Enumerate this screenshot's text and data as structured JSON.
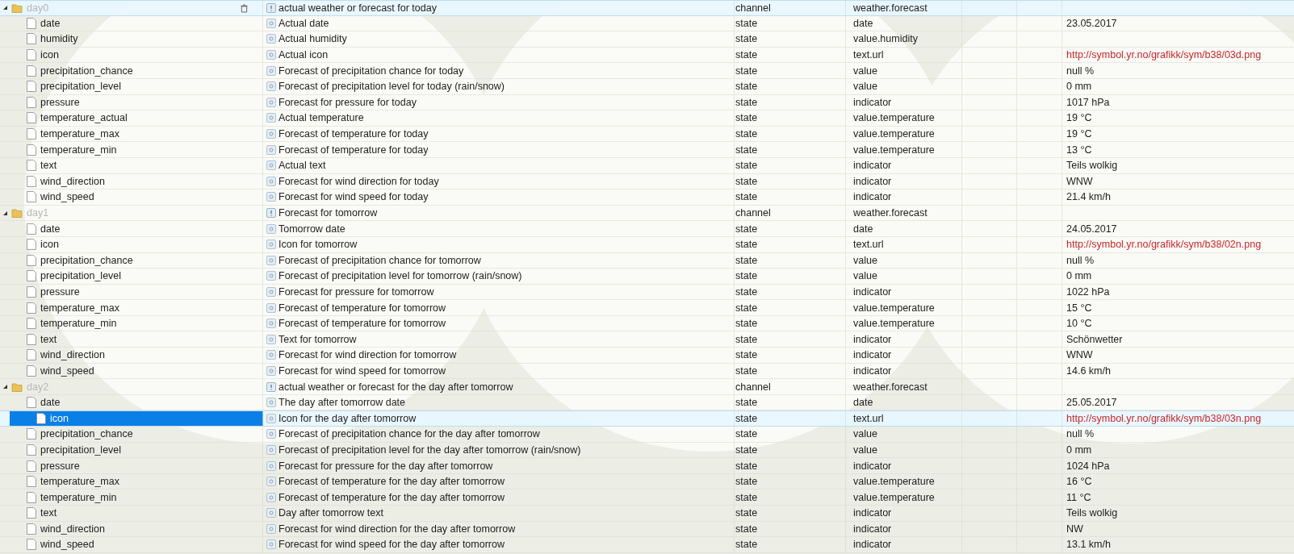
{
  "groups": [
    {
      "name": "day0",
      "description": "actual weather or forecast for today",
      "type": "channel",
      "role": "weather.forecast",
      "expanded": true,
      "highlighted": true,
      "children": [
        {
          "name": "date",
          "description": "Actual date",
          "type": "state",
          "role": "date",
          "value": "23.05.2017",
          "kind": "plain",
          "selected": false
        },
        {
          "name": "humidity",
          "description": "Actual humidity",
          "type": "state",
          "role": "value.humidity",
          "selected": false
        },
        {
          "name": "icon",
          "description": "Actual icon",
          "type": "state",
          "role": "text.url",
          "value": "http://symbol.yr.no/grafikk/sym/b38/03d.png",
          "kind": "url",
          "selected": false
        },
        {
          "name": "precipitation_chance",
          "description": "Forecast of precipitation chance for today",
          "type": "state",
          "role": "value",
          "value": "null %",
          "kind": "plain",
          "selected": false
        },
        {
          "name": "precipitation_level",
          "description": "Forecast of precipitation level for today (rain/snow)",
          "type": "state",
          "role": "value",
          "value": "0 mm",
          "kind": "plain",
          "selected": false
        },
        {
          "name": "pressure",
          "description": "Forecast for pressure for today",
          "type": "state",
          "role": "indicator",
          "value": "1017 hPa",
          "kind": "plain",
          "selected": false
        },
        {
          "name": "temperature_actual",
          "description": "Actual temperature",
          "type": "state",
          "role": "value.temperature",
          "value": "19 °C",
          "kind": "plain",
          "selected": false
        },
        {
          "name": "temperature_max",
          "description": "Forecast of temperature for today",
          "type": "state",
          "role": "value.temperature",
          "value": "19 °C",
          "kind": "plain",
          "selected": false
        },
        {
          "name": "temperature_min",
          "description": "Forecast of temperature for today",
          "type": "state",
          "role": "value.temperature",
          "value": "13 °C",
          "kind": "plain",
          "selected": false
        },
        {
          "name": "text",
          "description": "Actual text",
          "type": "state",
          "role": "indicator",
          "value": "Teils wolkig",
          "kind": "plain",
          "selected": false
        },
        {
          "name": "wind_direction",
          "description": "Forecast for wind direction for today",
          "type": "state",
          "role": "indicator",
          "value": "WNW",
          "kind": "plain",
          "selected": false
        },
        {
          "name": "wind_speed",
          "description": "Forecast for wind speed for today",
          "type": "state",
          "role": "indicator",
          "value": "21.4 km/h",
          "kind": "plain",
          "selected": false
        }
      ]
    },
    {
      "name": "day1",
      "description": "Forecast for tomorrow",
      "type": "channel",
      "role": "weather.forecast",
      "expanded": true,
      "highlighted": false,
      "children": [
        {
          "name": "date",
          "description": "Tomorrow date",
          "type": "state",
          "role": "date",
          "value": "24.05.2017",
          "kind": "plain",
          "selected": false
        },
        {
          "name": "icon",
          "description": "Icon for tomorrow",
          "type": "state",
          "role": "text.url",
          "value": "http://symbol.yr.no/grafikk/sym/b38/02n.png",
          "kind": "url",
          "selected": false
        },
        {
          "name": "precipitation_chance",
          "description": "Forecast of precipitation chance for tomorrow",
          "type": "state",
          "role": "value",
          "value": "null %",
          "kind": "plain",
          "selected": false
        },
        {
          "name": "precipitation_level",
          "description": "Forecast of precipitation level for tomorrow (rain/snow)",
          "type": "state",
          "role": "value",
          "value": "0 mm",
          "kind": "plain",
          "selected": false
        },
        {
          "name": "pressure",
          "description": "Forecast for pressure for tomorrow",
          "type": "state",
          "role": "indicator",
          "value": "1022 hPa",
          "kind": "plain",
          "selected": false
        },
        {
          "name": "temperature_max",
          "description": "Forecast of temperature for tomorrow",
          "type": "state",
          "role": "value.temperature",
          "value": "15 °C",
          "kind": "plain",
          "selected": false
        },
        {
          "name": "temperature_min",
          "description": "Forecast of temperature for tomorrow",
          "type": "state",
          "role": "value.temperature",
          "value": "10 °C",
          "kind": "plain",
          "selected": false
        },
        {
          "name": "text",
          "description": "Text for tomorrow",
          "type": "state",
          "role": "indicator",
          "value": "Schönwetter",
          "kind": "plain",
          "selected": false
        },
        {
          "name": "wind_direction",
          "description": "Forecast for wind direction for tomorrow",
          "type": "state",
          "role": "indicator",
          "value": "WNW",
          "kind": "plain",
          "selected": false
        },
        {
          "name": "wind_speed",
          "description": "Forecast for wind speed for tomorrow",
          "type": "state",
          "role": "indicator",
          "value": "14.6 km/h",
          "kind": "plain",
          "selected": false
        }
      ]
    },
    {
      "name": "day2",
      "description": "actual weather or forecast for the day after tomorrow",
      "type": "channel",
      "role": "weather.forecast",
      "expanded": true,
      "highlighted": false,
      "children": [
        {
          "name": "date",
          "description": "The day after tomorrow date",
          "type": "state",
          "role": "date",
          "value": "25.05.2017",
          "kind": "plain",
          "selected": false
        },
        {
          "name": "icon",
          "description": "Icon for the day after tomorrow",
          "type": "state",
          "role": "text.url",
          "value": "http://symbol.yr.no/grafikk/sym/b38/03n.png",
          "kind": "url",
          "selected": true
        },
        {
          "name": "precipitation_chance",
          "description": "Forecast of precipitation chance for the day after tomorrow",
          "type": "state",
          "role": "value",
          "value": "null %",
          "kind": "plain",
          "selected": false
        },
        {
          "name": "precipitation_level",
          "description": "Forecast of precipitation level for the day after tomorrow (rain/snow)",
          "type": "state",
          "role": "value",
          "value": "0 mm",
          "kind": "plain",
          "selected": false
        },
        {
          "name": "pressure",
          "description": "Forecast for pressure for the day after tomorrow",
          "type": "state",
          "role": "indicator",
          "value": "1024 hPa",
          "kind": "plain",
          "selected": false
        },
        {
          "name": "temperature_max",
          "description": "Forecast of temperature for the day after tomorrow",
          "type": "state",
          "role": "value.temperature",
          "value": "16 °C",
          "kind": "plain",
          "selected": false
        },
        {
          "name": "temperature_min",
          "description": "Forecast of temperature for the day after tomorrow",
          "type": "state",
          "role": "value.temperature",
          "value": "11 °C",
          "kind": "plain",
          "selected": false
        },
        {
          "name": "text",
          "description": "Day after tomorrow text",
          "type": "state",
          "role": "indicator",
          "value": "Teils wolkig",
          "kind": "plain",
          "selected": false
        },
        {
          "name": "wind_direction",
          "description": "Forecast for wind direction for the day after tomorrow",
          "type": "state",
          "role": "indicator",
          "value": "NW",
          "kind": "plain",
          "selected": false
        },
        {
          "name": "wind_speed",
          "description": "Forecast for wind speed for the day after tomorrow",
          "type": "state",
          "role": "indicator",
          "value": "13.1 km/h",
          "kind": "plain",
          "selected": false
        }
      ]
    }
  ]
}
